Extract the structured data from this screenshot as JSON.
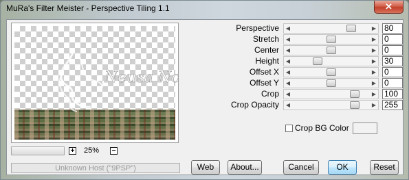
{
  "window": {
    "title": "MuRa's Filter Meister - Perspective Tiling 1.1",
    "close_glyph": "✕"
  },
  "preview": {
    "watermark_text": "Neusa Novaes",
    "zoom": {
      "minus_glyph": "−",
      "plus_glyph": "+",
      "label": "25%"
    },
    "host_text": "Unknown Host (\"9PSP\")"
  },
  "params": [
    {
      "label": "Perspective",
      "value": "80",
      "level": 0.8
    },
    {
      "label": "Stretch",
      "value": "0",
      "level": 0.5
    },
    {
      "label": "Center",
      "value": "0",
      "level": 0.5
    },
    {
      "label": "Height",
      "value": "30",
      "level": 0.3
    },
    {
      "label": "Offset X",
      "value": "0",
      "level": 0.5
    },
    {
      "label": "Offset Y",
      "value": "0",
      "level": 0.5
    },
    {
      "label": "Crop",
      "value": "100",
      "level": 0.85
    },
    {
      "label": "Crop Opacity",
      "value": "255",
      "level": 0.85
    }
  ],
  "crop_bg": {
    "label": "Crop BG Color",
    "checked": false,
    "color": "#f2f2f2"
  },
  "buttons": {
    "web": "Web",
    "about": "About...",
    "cancel": "Cancel",
    "ok": "OK",
    "reset": "Reset"
  },
  "icons": {
    "slider_left": "◀",
    "slider_right": "▶"
  }
}
